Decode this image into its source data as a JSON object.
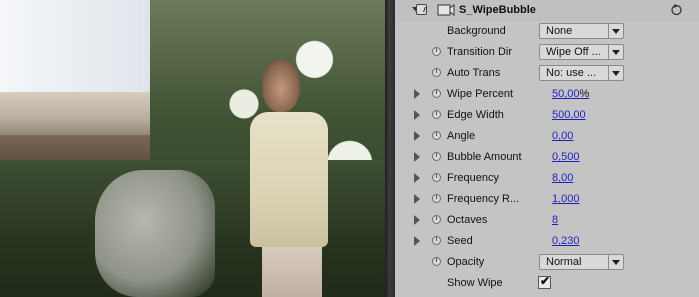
{
  "effect": {
    "name": "S_WipeBubble",
    "icons": {
      "fx_toggle": "fx-switch-icon",
      "effect": "effect-film-icon",
      "reset": "reset-icon"
    }
  },
  "params": [
    {
      "label": "Background",
      "kind": "dropdown",
      "value": "None"
    },
    {
      "label": "Transition Dir",
      "kind": "dropdown",
      "value": "Wipe Off ..."
    },
    {
      "label": "Auto Trans",
      "kind": "dropdown",
      "value": "No: use ..."
    },
    {
      "label": "Wipe Percent",
      "kind": "number",
      "value": "50,00",
      "unit": "%"
    },
    {
      "label": "Edge Width",
      "kind": "number",
      "value": "500,00"
    },
    {
      "label": "Angle",
      "kind": "number",
      "value": "0,00"
    },
    {
      "label": "Bubble Amount",
      "kind": "number",
      "value": "0,500"
    },
    {
      "label": "Frequency",
      "kind": "number",
      "value": "8,00"
    },
    {
      "label": "Frequency R...",
      "kind": "number",
      "value": "1,000"
    },
    {
      "label": "Octaves",
      "kind": "number",
      "value": "8"
    },
    {
      "label": "Seed",
      "kind": "number",
      "value": "0,230"
    },
    {
      "label": "Opacity",
      "kind": "dropdown",
      "value": "Normal"
    },
    {
      "label": "Show Wipe",
      "kind": "checkbox",
      "checked": true
    }
  ]
}
